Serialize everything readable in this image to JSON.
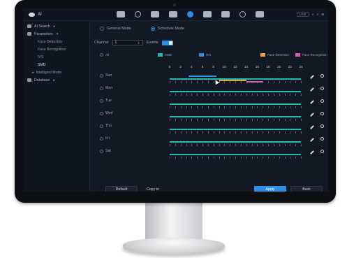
{
  "topbar": {
    "brand": "AI",
    "icons": [
      "home-icon",
      "playback-icon",
      "storage-icon",
      "face-icon",
      "ai-icon",
      "camera-icon",
      "sync-icon",
      "display-icon",
      "headset-icon"
    ],
    "active_icon_index": 4,
    "right_chips": [
      "LIVE",
      "A",
      "2",
      "⊞"
    ]
  },
  "sidebar": {
    "items": [
      {
        "label": "AI Search",
        "level": 0,
        "expand": "▸"
      },
      {
        "label": "Parameters",
        "level": 0,
        "expand": "▾"
      },
      {
        "label": "Face Detection",
        "level": 1
      },
      {
        "label": "Face Recognition",
        "level": 1
      },
      {
        "label": "IVS",
        "level": 1
      },
      {
        "label": "SMD",
        "level": 1,
        "selected": true
      },
      {
        "label": "Intelligent Mode",
        "level": 1
      },
      {
        "label": "Database",
        "level": 0,
        "expand": "▸"
      }
    ]
  },
  "modes": {
    "general": "General Mode",
    "schedule": "Schedule Mode",
    "selected": "schedule"
  },
  "channel": {
    "label": "Channel",
    "value": "1",
    "enable_label": "Enable",
    "enabled": true
  },
  "legend": {
    "all_label": "All",
    "items": [
      {
        "label": "SMD",
        "color": "#21b8b0"
      },
      {
        "label": "IVS",
        "color": "#2e8fe8"
      },
      {
        "label": "Face Detection",
        "color": "#e8a23a"
      },
      {
        "label": "Face Recognition",
        "color": "#d65ab7"
      }
    ]
  },
  "hours": [
    "0",
    "2",
    "4",
    "6",
    "8",
    "10",
    "12",
    "14",
    "16",
    "18",
    "20",
    "22",
    "24"
  ],
  "days": [
    {
      "label": "Sun",
      "segments": [
        {
          "type": "SMD",
          "start": 0,
          "end": 24,
          "lane": "main"
        },
        {
          "type": "IVS",
          "start": 3.5,
          "end": 8.5,
          "lane": "up"
        },
        {
          "type": "Face Detection",
          "start": 9,
          "end": 14,
          "lane": "down"
        },
        {
          "type": "Face Recognition",
          "start": 14,
          "end": 17,
          "lane": "down2"
        }
      ]
    },
    {
      "label": "Mon",
      "segments": [
        {
          "type": "SMD",
          "start": 0,
          "end": 24,
          "lane": "main"
        }
      ]
    },
    {
      "label": "Tue",
      "segments": [
        {
          "type": "SMD",
          "start": 0,
          "end": 24,
          "lane": "main"
        }
      ]
    },
    {
      "label": "Wed",
      "segments": [
        {
          "type": "SMD",
          "start": 0,
          "end": 24,
          "lane": "main"
        }
      ]
    },
    {
      "label": "Thu",
      "segments": [
        {
          "type": "SMD",
          "start": 0,
          "end": 24,
          "lane": "main"
        }
      ]
    },
    {
      "label": "Fri",
      "segments": [
        {
          "type": "SMD",
          "start": 0,
          "end": 24,
          "lane": "main"
        }
      ]
    },
    {
      "label": "Sat",
      "segments": [
        {
          "type": "SMD",
          "start": 0,
          "end": 24,
          "lane": "main"
        }
      ]
    }
  ],
  "buttons": {
    "default": "Default",
    "copy_to": "Copy to",
    "apply": "Apply",
    "back": "Back"
  }
}
